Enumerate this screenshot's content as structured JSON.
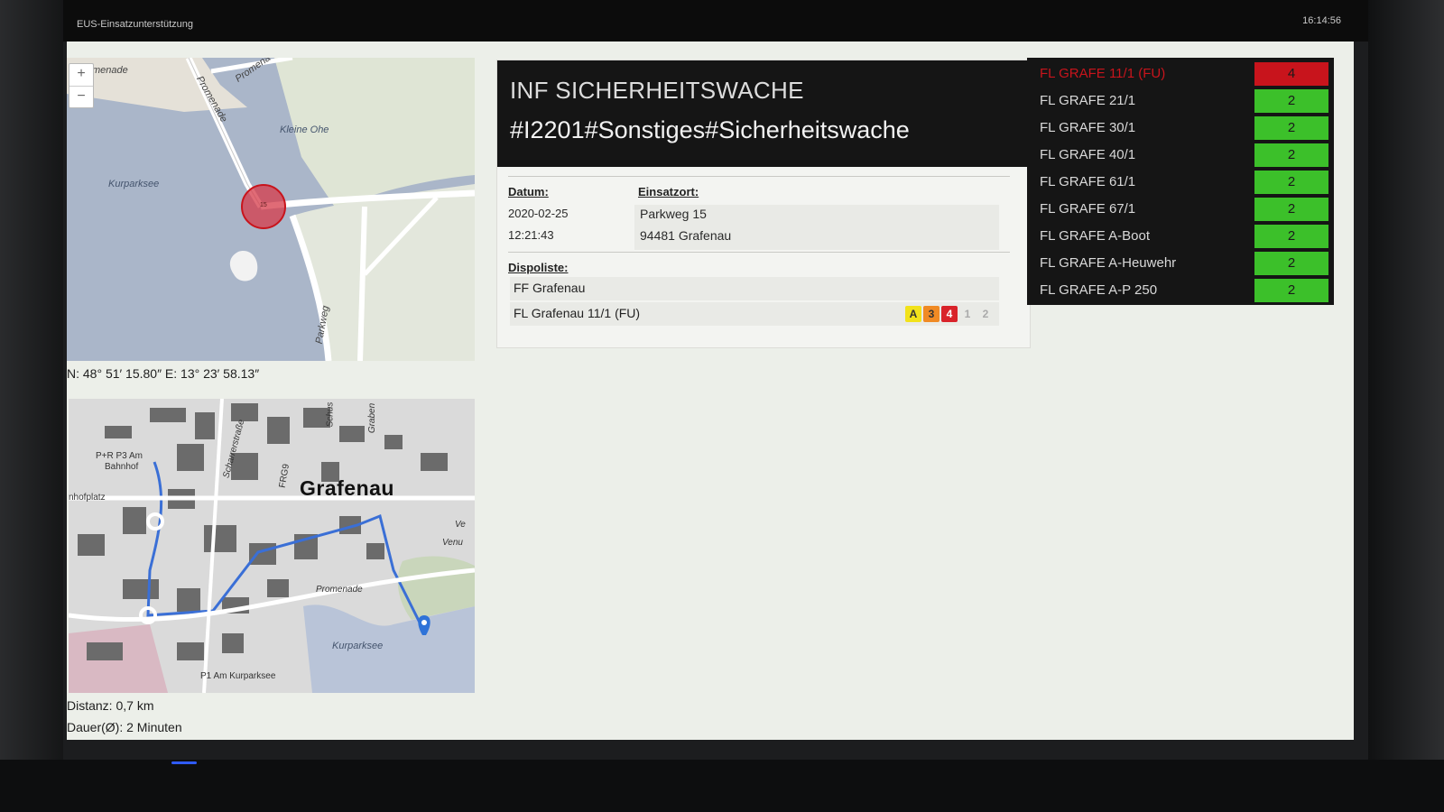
{
  "app": {
    "title": "EUS-Einsatzunterstützung",
    "clock": "16:14:56"
  },
  "map_top": {
    "zoom_in": "+",
    "zoom_out": "−",
    "labels": {
      "kleine_ohe": "Kleine Ohe",
      "kurparksee": "Kurparksee",
      "promenade_a": "menade",
      "promenade_b": "Promena",
      "promenade_c": "Promenade",
      "parkweg": "Parkweg"
    },
    "marker_label": "15",
    "coordinates": "N: 48° 51′ 15.80″ E: 13° 23′ 58.13″"
  },
  "map_route": {
    "town": "Grafenau",
    "labels": {
      "pr": "P+R P3 Am",
      "bahnhof": "Bahnhof",
      "bahnhofplatz": "nhofplatz",
      "kurparksee": "Kurparksee",
      "p1": "P1 Am Kurparksee",
      "promenade": "Promenade",
      "fr": "FRG9",
      "schus": "Schus",
      "graben": "Graben",
      "scharrer": "Scharrerstraße",
      "venu": "Venu",
      "ve": "Ve"
    },
    "distance": "Distanz: 0,7 km",
    "duration": "Dauer(Ø): 2 Minuten"
  },
  "incident": {
    "type": "INF SICHERHEITSWACHE",
    "code": "#I2201#Sonstiges#Sicherheitswache",
    "date_label": "Datum:",
    "date": "2020-02-25",
    "time": "12:21:43",
    "location_label": "Einsatzort:",
    "street": "Parkweg 15",
    "city": "94481 Grafenau",
    "dispo_label": "Dispoliste:",
    "dispo": [
      {
        "name": "FF Grafenau"
      },
      {
        "name": "FL Grafenau 11/1 (FU)",
        "statuses": [
          {
            "code": "A",
            "bg": "#f2e21a",
            "fg": "#333333"
          },
          {
            "code": "3",
            "bg": "#f08a24",
            "fg": "#333333"
          },
          {
            "code": "4",
            "bg": "#d9232a",
            "fg": "#ffffff"
          },
          {
            "code": "1",
            "bg": "transparent",
            "fg": "#aaaaaa"
          },
          {
            "code": "2",
            "bg": "transparent",
            "fg": "#aaaaaa"
          }
        ]
      }
    ]
  },
  "units": [
    {
      "name": "FL GRAFE 11/1 (FU)",
      "status": "4",
      "alert": true
    },
    {
      "name": "FL GRAFE 21/1",
      "status": "2",
      "alert": false
    },
    {
      "name": "FL GRAFE 30/1",
      "status": "2",
      "alert": false
    },
    {
      "name": "FL GRAFE 40/1",
      "status": "2",
      "alert": false
    },
    {
      "name": "FL GRAFE 61/1",
      "status": "2",
      "alert": false
    },
    {
      "name": "FL GRAFE 67/1",
      "status": "2",
      "alert": false
    },
    {
      "name": "FL GRAFE A-Boot",
      "status": "2",
      "alert": false
    },
    {
      "name": "FL GRAFE A-Heuwehr",
      "status": "2",
      "alert": false
    },
    {
      "name": "FL GRAFE A-P 250",
      "status": "2",
      "alert": false
    }
  ],
  "colors": {
    "alert_red": "#c8141c",
    "ok_green": "#3cc02a",
    "header_black": "#151515"
  }
}
